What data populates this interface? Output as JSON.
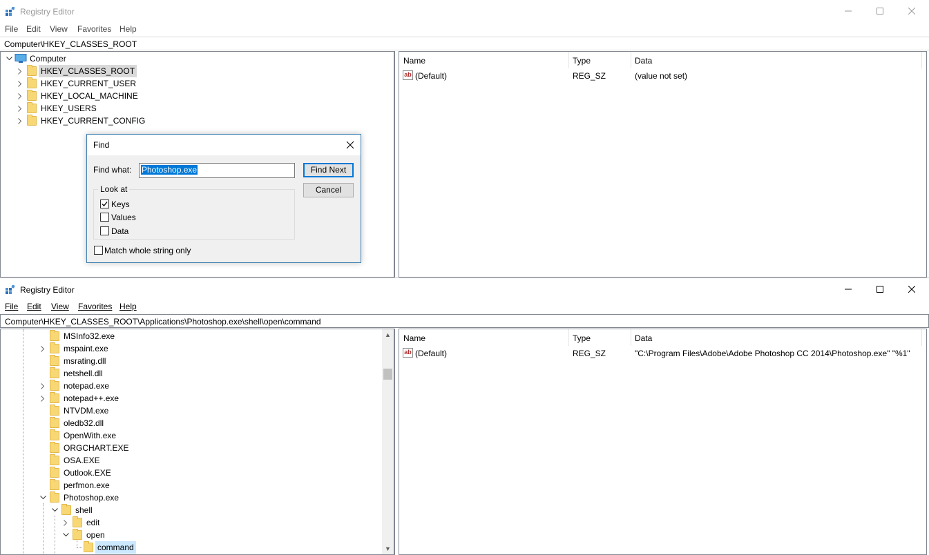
{
  "window1": {
    "title": "Registry Editor",
    "menu": [
      "File",
      "Edit",
      "View",
      "Favorites",
      "Help"
    ],
    "address": "Computer\\HKEY_CLASSES_ROOT",
    "tree": {
      "root": "Computer",
      "items": [
        "HKEY_CLASSES_ROOT",
        "HKEY_CURRENT_USER",
        "HKEY_LOCAL_MACHINE",
        "HKEY_USERS",
        "HKEY_CURRENT_CONFIG"
      ]
    },
    "list": {
      "columns": [
        "Name",
        "Type",
        "Data"
      ],
      "rows": [
        {
          "name": "(Default)",
          "type": "REG_SZ",
          "data": "(value not set)"
        }
      ]
    }
  },
  "find_dialog": {
    "title": "Find",
    "find_what_label": "Find what:",
    "find_what_value": "Photoshop.exe",
    "find_next": "Find Next",
    "cancel": "Cancel",
    "look_at_label": "Look at",
    "keys_label": "Keys",
    "keys_checked": true,
    "values_label": "Values",
    "values_checked": false,
    "data_label": "Data",
    "data_checked": false,
    "match_whole_label": "Match whole string only",
    "match_whole_checked": false
  },
  "window2": {
    "title": "Registry Editor",
    "menu": [
      "File",
      "Edit",
      "View",
      "Favorites",
      "Help"
    ],
    "address": "Computer\\HKEY_CLASSES_ROOT\\Applications\\Photoshop.exe\\shell\\open\\command",
    "tree": [
      "MSInfo32.exe",
      "mspaint.exe",
      "msrating.dll",
      "netshell.dll",
      "notepad.exe",
      "notepad++.exe",
      "NTVDM.exe",
      "oledb32.dll",
      "OpenWith.exe",
      "ORGCHART.EXE",
      "OSA.EXE",
      "Outlook.EXE",
      "perfmon.exe",
      "Photoshop.exe",
      "shell",
      "edit",
      "open",
      "command"
    ],
    "list": {
      "columns": [
        "Name",
        "Type",
        "Data"
      ],
      "rows": [
        {
          "name": "(Default)",
          "type": "REG_SZ",
          "data": "\"C:\\Program Files\\Adobe\\Adobe Photoshop CC 2014\\Photoshop.exe\" \"%1\""
        }
      ]
    }
  }
}
